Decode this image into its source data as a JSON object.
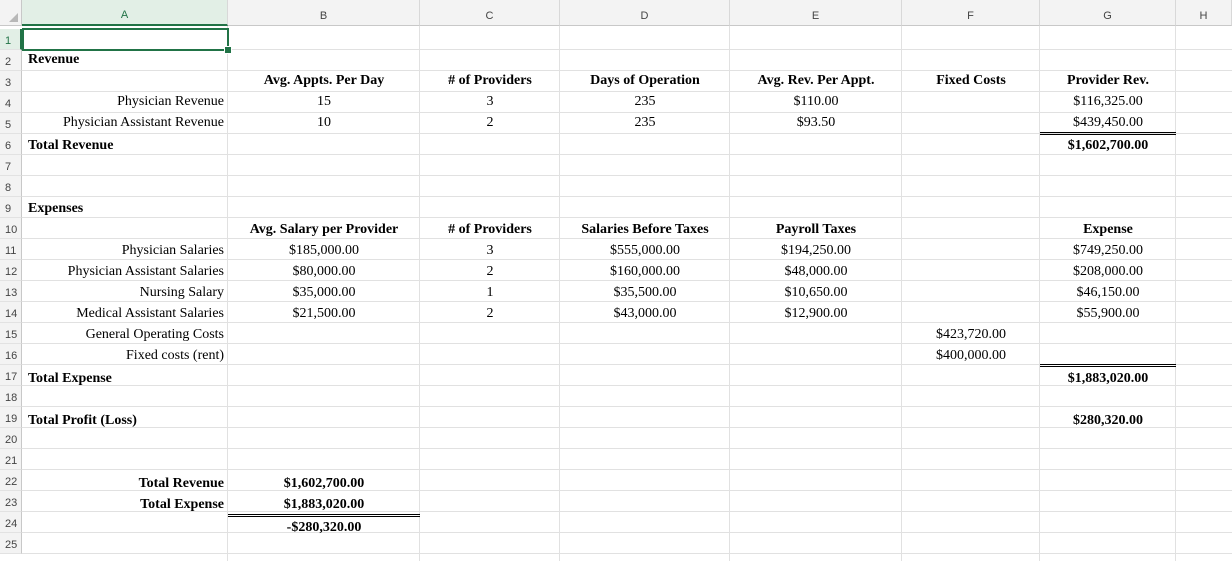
{
  "columns": [
    "A",
    "B",
    "C",
    "D",
    "E",
    "F",
    "G",
    "H"
  ],
  "rows": [
    "1",
    "2",
    "3",
    "4",
    "5",
    "6",
    "7",
    "8",
    "9",
    "10",
    "11",
    "12",
    "13",
    "14",
    "15",
    "16",
    "17",
    "18",
    "19",
    "20",
    "21",
    "22",
    "23",
    "24",
    "25"
  ],
  "r2": {
    "a": "Revenue"
  },
  "r3": {
    "b": "Avg. Appts. Per Day",
    "c": "# of Providers",
    "d": "Days of Operation",
    "e": "Avg. Rev. Per Appt.",
    "f": "Fixed Costs",
    "g": "Provider Rev."
  },
  "r4": {
    "a": "Physician Revenue",
    "b": "15",
    "c": "3",
    "d": "235",
    "e": "$110.00",
    "g": "$116,325.00"
  },
  "r5": {
    "a": "Physician Assistant Revenue",
    "b": "10",
    "c": "2",
    "d": "235",
    "e": "$93.50",
    "g": "$439,450.00"
  },
  "r6": {
    "a": "Total Revenue",
    "g": "$1,602,700.00"
  },
  "r9": {
    "a": "Expenses"
  },
  "r10": {
    "b": "Avg. Salary per Provider",
    "c": "# of Providers",
    "d": "Salaries Before Taxes",
    "e": "Payroll Taxes",
    "g": "Expense"
  },
  "r11": {
    "a": "Physician Salaries",
    "b": "$185,000.00",
    "c": "3",
    "d": "$555,000.00",
    "e": "$194,250.00",
    "g": "$749,250.00"
  },
  "r12": {
    "a": "Physician Assistant Salaries",
    "b": "$80,000.00",
    "c": "2",
    "d": "$160,000.00",
    "e": "$48,000.00",
    "g": "$208,000.00"
  },
  "r13": {
    "a": "Nursing Salary",
    "b": "$35,000.00",
    "c": "1",
    "d": "$35,500.00",
    "e": "$10,650.00",
    "g": "$46,150.00"
  },
  "r14": {
    "a": "Medical Assistant Salaries",
    "b": "$21,500.00",
    "c": "2",
    "d": "$43,000.00",
    "e": "$12,900.00",
    "g": "$55,900.00"
  },
  "r15": {
    "a": "General Operating Costs",
    "f": "$423,720.00"
  },
  "r16": {
    "a": "Fixed costs (rent)",
    "f": "$400,000.00"
  },
  "r17": {
    "a": "Total Expense",
    "g": "$1,883,020.00"
  },
  "r19": {
    "a": "Total Profit (Loss)",
    "g": "$280,320.00"
  },
  "r22": {
    "a": "Total Revenue",
    "b": "$1,602,700.00"
  },
  "r23": {
    "a": "Total Expense",
    "b": "$1,883,020.00"
  },
  "r24": {
    "b": "-$280,320.00"
  },
  "colors": {
    "selection": "#217346",
    "header_bg": "#f3f3f3",
    "grid": "#e1e1e1"
  }
}
